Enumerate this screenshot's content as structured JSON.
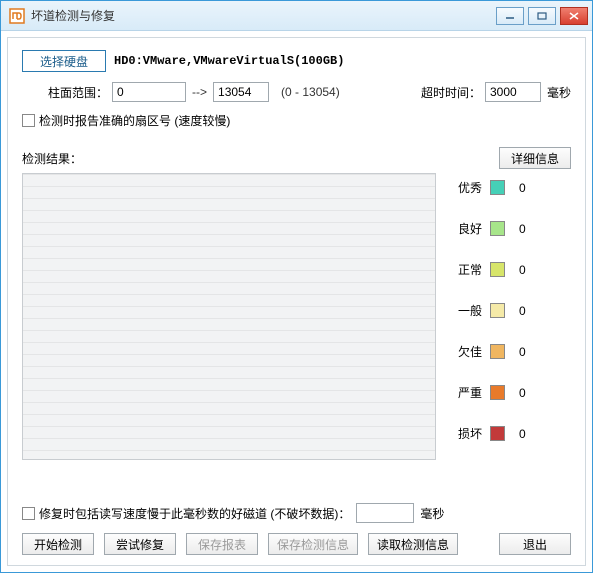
{
  "window": {
    "title": "坏道检测与修复"
  },
  "toolbar": {
    "select_disk": "选择硬盘",
    "disk_name": "HD0:VMware,VMwareVirtualS(100GB)"
  },
  "cylinder": {
    "label": "柱面范围：",
    "from": "0",
    "arrow": "-->",
    "to": "13054",
    "hint": "(0 - 13054)"
  },
  "timeout": {
    "label": "超时时间：",
    "value": "3000",
    "unit": "毫秒"
  },
  "option_accurate": {
    "label": "检测时报告准确的扇区号 (速度较慢)"
  },
  "results": {
    "label": "检测结果：",
    "detail_btn": "详细信息"
  },
  "legend": [
    {
      "label": "优秀",
      "color": "#45d0b7",
      "count": "0"
    },
    {
      "label": "良好",
      "color": "#a7e58a",
      "count": "0"
    },
    {
      "label": "正常",
      "color": "#d7e56a",
      "count": "0"
    },
    {
      "label": "一般",
      "color": "#f5eaa8",
      "count": "0"
    },
    {
      "label": "欠佳",
      "color": "#f0b660",
      "count": "0"
    },
    {
      "label": "严重",
      "color": "#e87a2a",
      "count": "0"
    },
    {
      "label": "损坏",
      "color": "#c23a3a",
      "count": "0"
    }
  ],
  "repair_opt": {
    "label": "修复时包括读写速度慢于此毫秒数的好磁道 (不破坏数据)：",
    "value": "",
    "unit": "毫秒"
  },
  "buttons": {
    "start": "开始检测",
    "try_repair": "尝试修复",
    "save_report": "保存报表",
    "save_info": "保存检测信息",
    "read_info": "读取检测信息",
    "exit": "退出"
  }
}
